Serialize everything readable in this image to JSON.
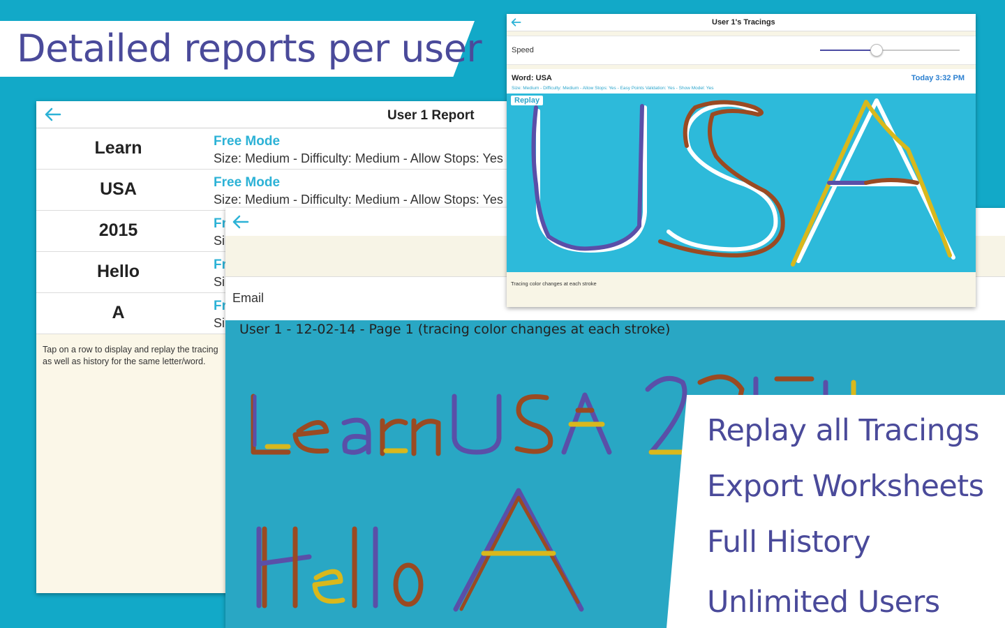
{
  "banner": {
    "title": "Detailed reports per user"
  },
  "report": {
    "title": "User 1 Report",
    "rows": [
      {
        "word": "Learn",
        "mode": "Free Mode",
        "settings": "Size: Medium - Difficulty: Medium - Allow Stops: Yes"
      },
      {
        "word": "USA",
        "mode": "Free Mode",
        "settings": "Size: Medium - Difficulty: Medium - Allow Stops: Yes"
      },
      {
        "word": "2015",
        "mode": "Fr",
        "settings": "Si"
      },
      {
        "word": "Hello",
        "mode": "Fr",
        "settings": "Si"
      },
      {
        "word": "A",
        "mode": "Fr",
        "settings": "Si"
      }
    ],
    "note": "Tap on a row to display and replay the tracing as well as history for the same letter/word."
  },
  "export": {
    "email_label": "Email",
    "caption": "User 1 - 12-02-14 - Page 1 (tracing color changes at each stroke)"
  },
  "tracings": {
    "title": "User 1's Tracings",
    "speed_label": "Speed",
    "speed_level": 0.4,
    "word": "Word: USA",
    "date": "Today 3:32 PM",
    "params": "Size: Medium - Difficulty: Medium - Allow Stops: Yes - Easy Points Validation: Yes - Show Model: Yes",
    "replay_label": "Replay",
    "footnote": "Tracing color changes at each stroke"
  },
  "features": [
    "Replay all Tracings",
    "Export Worksheets",
    "Full History",
    "Unlimited Users"
  ],
  "colors": {
    "background": "#12a9c8",
    "accent_blue": "#2cb2d6",
    "heading_purple": "#4a4a9a",
    "stroke_purple": "#5a4fa8",
    "stroke_brown": "#9a4a22",
    "stroke_yellow": "#d9b81c"
  }
}
